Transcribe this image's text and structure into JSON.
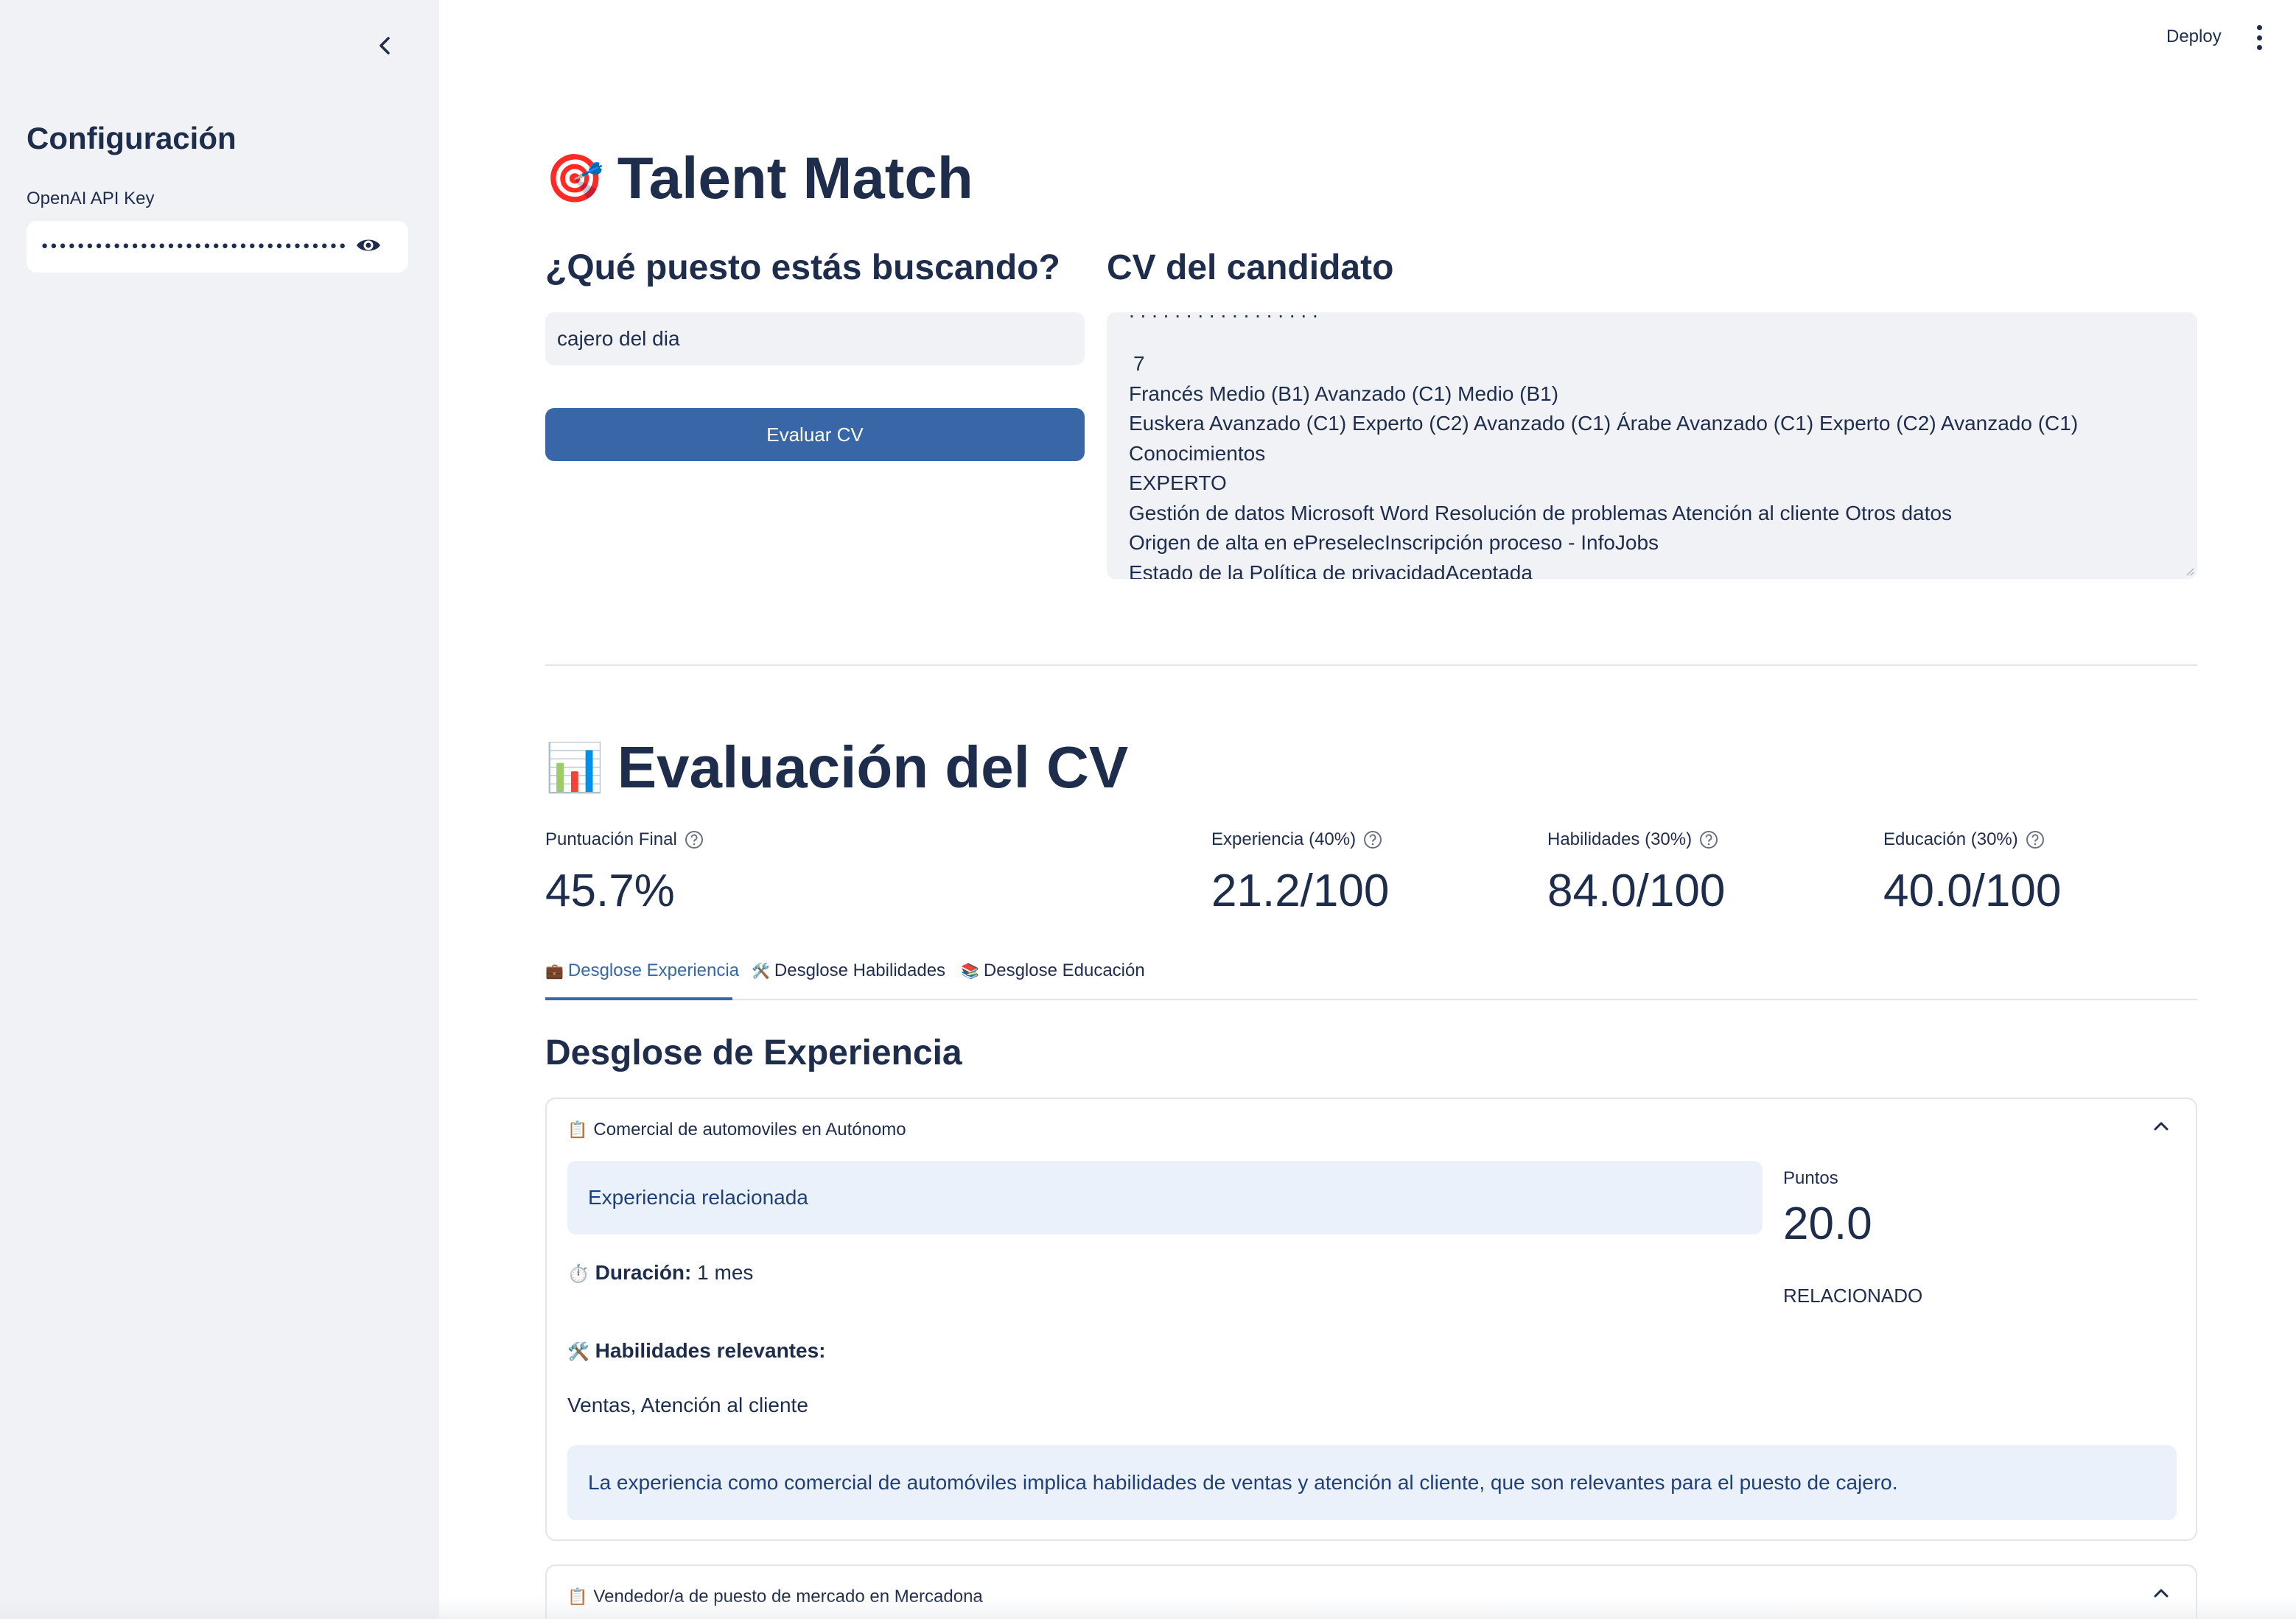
{
  "sidebar": {
    "title": "Configuración",
    "api_key_label": "OpenAI API Key",
    "api_key_value": "••••••••••••••••••••••••••••••••••••••••••••••••••••••"
  },
  "header": {
    "deploy_label": "Deploy"
  },
  "main": {
    "title_icon": "🎯",
    "title": "Talent Match",
    "job_section": {
      "heading": "¿Qué puesto estás buscando?",
      "job_value": "cajero del dia",
      "evaluate_button": "Evaluar CV"
    },
    "cv_section": {
      "heading": "CV del candidato",
      "lines": [
        "7",
        "Francés Medio (B1) Avanzado (C1) Medio (B1)",
        "Euskera Avanzado (C1) Experto (C2) Avanzado (C1) Árabe Avanzado (C1) Experto (C2) Avanzado (C1) Conocimientos",
        "EXPERTO",
        "Gestión de datos Microsoft Word Resolución de problemas Atención al cliente Otros datos",
        "Origen de alta en ePreselecInscripción proceso - InfoJobs",
        "Estado de la Política de privacidadAceptada"
      ]
    },
    "evaluation": {
      "title_icon": "📊",
      "title": "Evaluación del CV",
      "metrics": [
        {
          "label": "Puntuación Final",
          "value": "45.7%"
        },
        {
          "label": "Experiencia (40%)",
          "value": "21.2/100"
        },
        {
          "label": "Habilidades (30%)",
          "value": "84.0/100"
        },
        {
          "label": "Educación (30%)",
          "value": "40.0/100"
        }
      ],
      "tabs": [
        {
          "icon": "💼",
          "label": "Desglose Experiencia"
        },
        {
          "icon": "🛠️",
          "label": "Desglose Habilidades"
        },
        {
          "icon": "📚",
          "label": "Desglose Educación"
        }
      ],
      "breakdown": {
        "heading": "Desglose de Experiencia",
        "entries": [
          {
            "icon": "📋",
            "title": "Comercial de automoviles en Autónomo",
            "status_box": "Experiencia relacionada",
            "duration_icon": "⏱️",
            "duration_label": "Duración:",
            "duration_value": "1 mes",
            "skills_icon": "🛠️",
            "skills_label": "Habilidades relevantes:",
            "skills_value": "Ventas, Atención al cliente",
            "points_label": "Puntos",
            "points_value": "20.0",
            "relation": "RELACIONADO",
            "explanation": "La experiencia como comercial de automóviles implica habilidades de ventas y atención al cliente, que son relevantes para el puesto de cajero."
          },
          {
            "icon": "📋",
            "title": "Vendedor/a de puesto de mercado en Mercadona"
          }
        ]
      }
    }
  }
}
